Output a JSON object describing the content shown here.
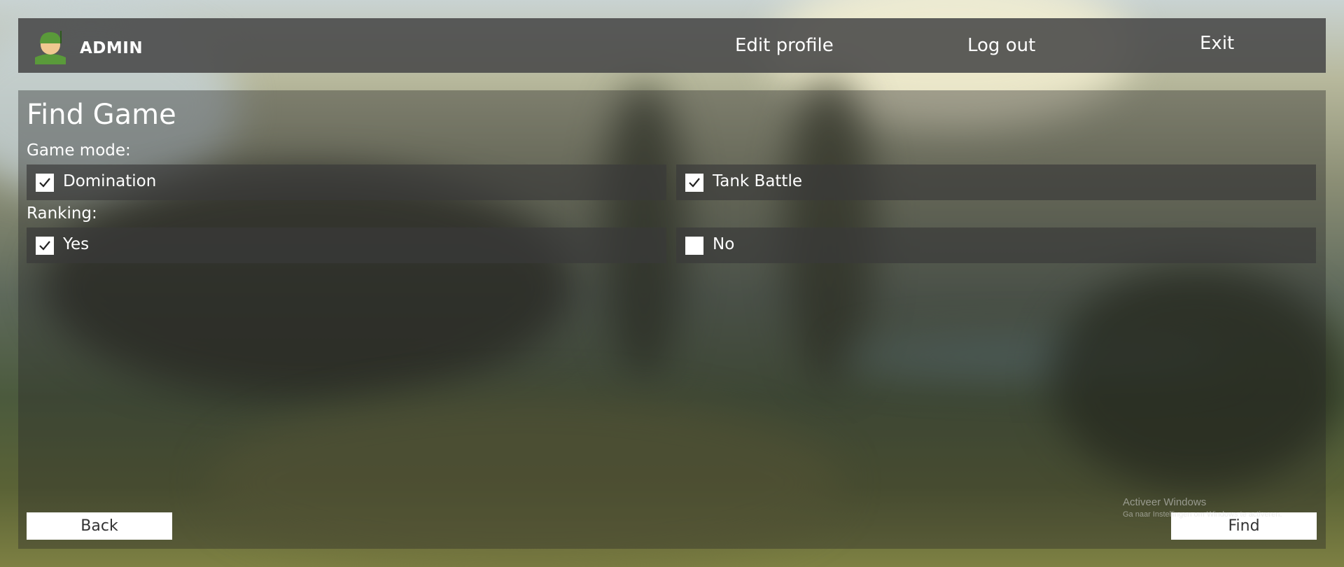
{
  "header": {
    "username": "ADMIN",
    "nav": {
      "edit_profile": "Edit profile",
      "log_out": "Log out",
      "exit": "Exit"
    }
  },
  "main": {
    "title": "Find Game",
    "game_mode": {
      "label": "Game mode:",
      "options": [
        {
          "label": "Domination",
          "checked": true
        },
        {
          "label": "Tank Battle",
          "checked": true
        }
      ]
    },
    "ranking": {
      "label": "Ranking:",
      "options": [
        {
          "label": "Yes",
          "checked": true
        },
        {
          "label": "No",
          "checked": false
        }
      ]
    },
    "buttons": {
      "back": "Back",
      "find": "Find"
    }
  },
  "watermark": {
    "title": "Activeer Windows",
    "subtitle": "Ga naar Instellingen om Windows te activeren."
  },
  "icons": {
    "avatar": "soldier-avatar-icon",
    "check": "checkmark-icon"
  },
  "colors": {
    "header_bg": "#484848",
    "avatar_helmet": "#5a9a3a",
    "avatar_face": "#f0c890",
    "button_bg": "#ffffff"
  }
}
